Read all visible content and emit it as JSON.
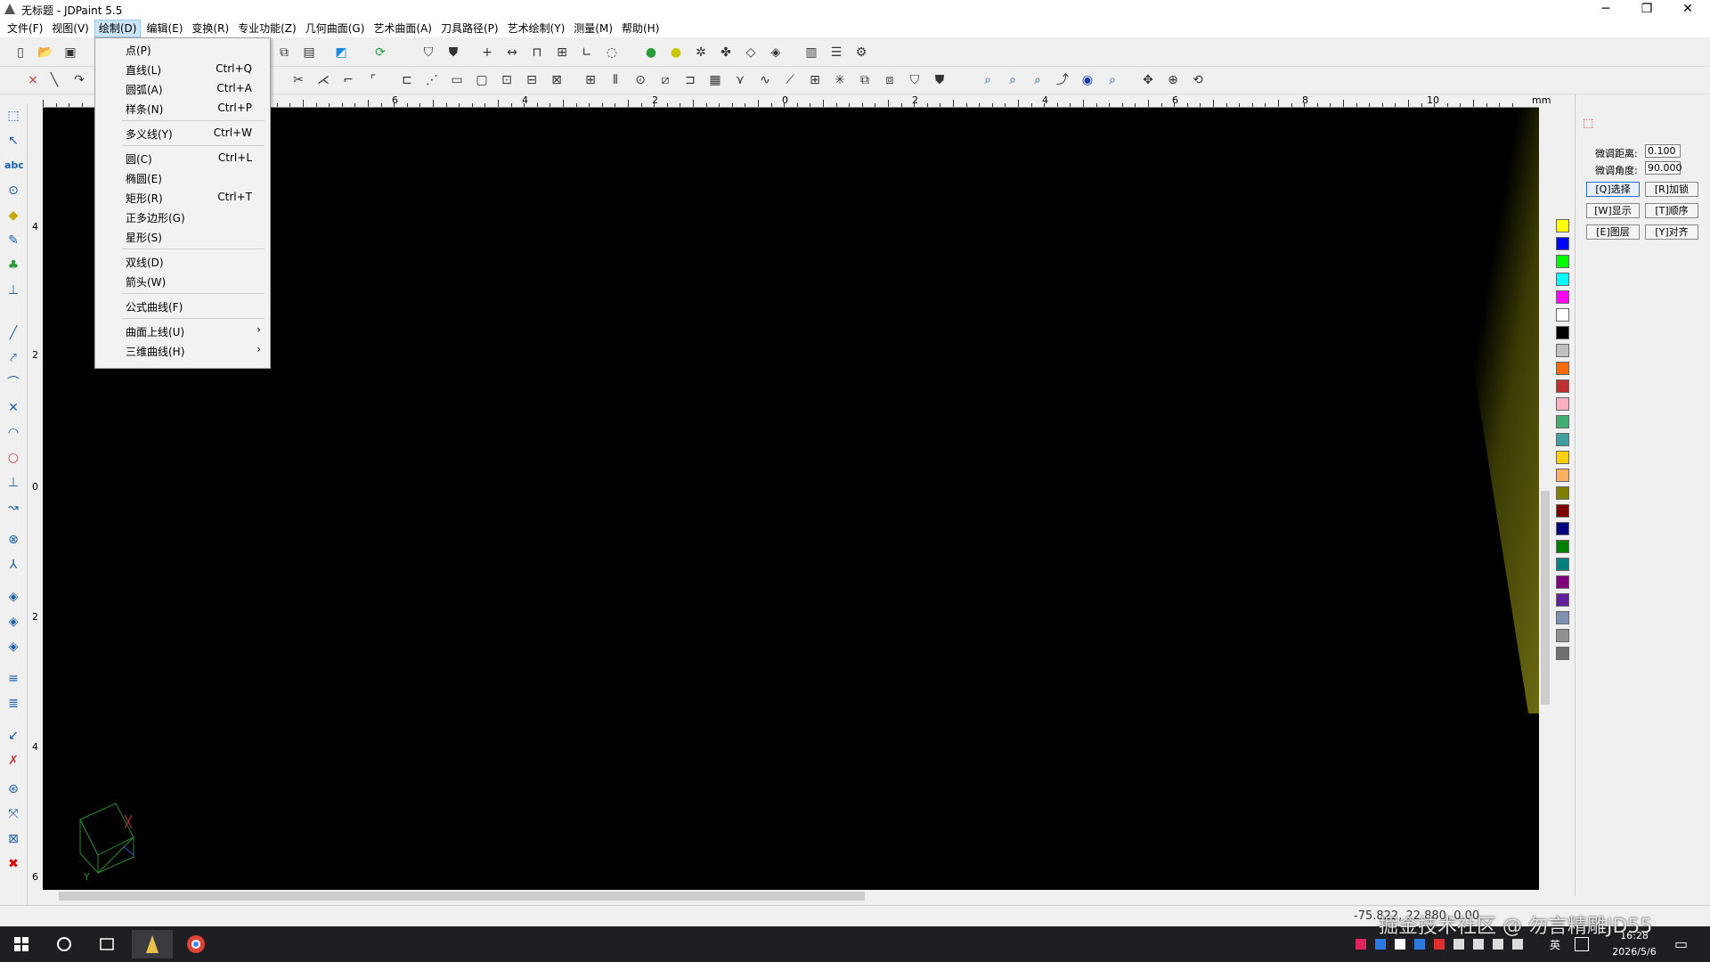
{
  "window": {
    "title": "无标题 - JDPaint 5.5",
    "minimize": "─",
    "restore": "❐",
    "close": "✕"
  },
  "menubar": [
    "文件(F)",
    "视图(V)",
    "绘制(D)",
    "编辑(E)",
    "变换(R)",
    "专业功能(Z)",
    "几何曲面(G)",
    "艺术曲面(A)",
    "刀具路径(P)",
    "艺术绘制(Y)",
    "测量(M)",
    "帮助(H)"
  ],
  "dropdown": {
    "items": [
      {
        "label": "点(P)",
        "key": ""
      },
      {
        "label": "直线(L)",
        "key": "Ctrl+Q"
      },
      {
        "label": "圆弧(A)",
        "key": "Ctrl+A"
      },
      {
        "label": "样条(N)",
        "key": "Ctrl+P"
      },
      {
        "label": "多义线(Y)",
        "key": "Ctrl+W"
      },
      {
        "label": "圆(C)",
        "key": "Ctrl+L"
      },
      {
        "label": "椭圆(E)",
        "key": ""
      },
      {
        "label": "矩形(R)",
        "key": "Ctrl+T"
      },
      {
        "label": "正多边形(G)",
        "key": ""
      },
      {
        "label": "星形(S)",
        "key": ""
      },
      {
        "label": "双线(D)",
        "key": ""
      },
      {
        "label": "箭头(W)",
        "key": ""
      },
      {
        "label": "公式曲线(F)",
        "key": ""
      },
      {
        "label": "曲面上线(U)",
        "key": "›"
      },
      {
        "label": "三维曲线(H)",
        "key": "›"
      }
    ]
  },
  "ruler": {
    "unit": "mm",
    "top_labels": [
      "6",
      "4",
      "2",
      "0",
      "2",
      "4",
      "6",
      "8",
      "10"
    ],
    "left_labels": [
      "4",
      "2",
      "0",
      "2",
      "4",
      "6"
    ]
  },
  "panel": {
    "dist_label": "微调距离:",
    "dist_value": "0.100",
    "angle_label": "微调角度:",
    "angle_value": "90.000",
    "btn_select": "[Q]选择",
    "btn_lock": "[R]加锁",
    "btn_show": "[W]显示",
    "btn_order": "[T]顺序",
    "btn_layer": "[E]图层",
    "btn_align": "[Y]对齐"
  },
  "palette": [
    "#ffff00",
    "#0000ff",
    "#00ff00",
    "#00ffff",
    "#ff00ff",
    "#ffffff",
    "#000000",
    "#c0c0c0",
    "#ff6a00",
    "#c03030",
    "#ffb0c0",
    "#40b070",
    "#40a0a0",
    "#ffd000",
    "#ffb060",
    "#808000",
    "#800000",
    "#000080",
    "#008000",
    "#008080",
    "#800080",
    "#6020a0",
    "#8090b0",
    "#909090",
    "#707070"
  ],
  "status": {
    "coords": "-75.822, 22.880, 0.00"
  },
  "watermark": "掘金技术社区 @ 勿言精雕JD55",
  "taskbar": {
    "ime": "英",
    "time": "16:28",
    "date": "2026/5/6"
  },
  "axis": {
    "y_label": "Y"
  }
}
